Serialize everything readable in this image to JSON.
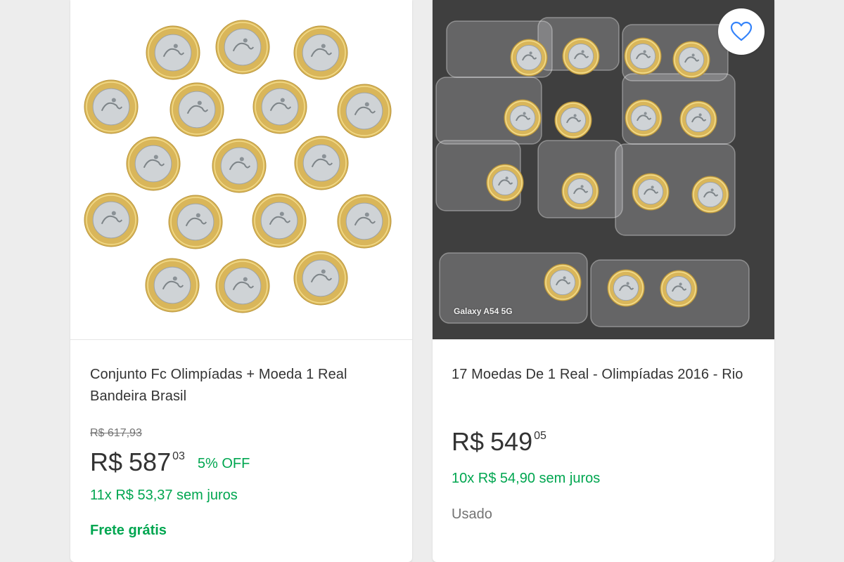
{
  "colors": {
    "background": "#ededed",
    "card": "#ffffff",
    "accent_green": "#00a650",
    "text_primary": "#333333",
    "text_secondary": "#737373",
    "favorite_blue": "#3483fa"
  },
  "listings": [
    {
      "title": "Conjunto Fc Olimpíadas + Moeda 1 Real Bandeira Brasil",
      "original_price": "R$ 617,93",
      "price": {
        "currency": "R$",
        "integer": "587",
        "cents": "03"
      },
      "discount": "5% OFF",
      "installments": "11x R$ 53,37 sem juros",
      "shipping": "Frete grátis",
      "image_icon": "coin-set-photo"
    },
    {
      "title": "17 Moedas De 1 Real - Olimpíadas 2016 - Rio",
      "price": {
        "currency": "R$",
        "integer": "549",
        "cents": "05"
      },
      "installments": "10x R$ 54,90 sem juros",
      "condition": "Usado",
      "image_watermark": "Galaxy A54 5G",
      "favorite_icon": "heart-outline-icon"
    }
  ]
}
